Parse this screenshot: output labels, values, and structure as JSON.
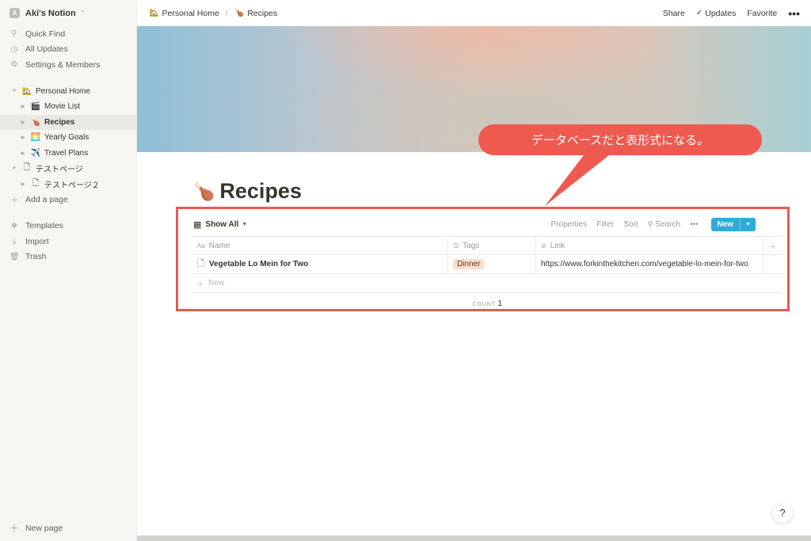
{
  "workspace": {
    "name": "Aki's Notion",
    "initial": "A"
  },
  "sidebar": {
    "top_items": [
      {
        "label": "Quick Find",
        "icon": "search-icon"
      },
      {
        "label": "All Updates",
        "icon": "clock-icon"
      },
      {
        "label": "Settings & Members",
        "icon": "gear-icon"
      }
    ],
    "tree": [
      {
        "label": "Personal Home",
        "emoji": "🏡",
        "level": 0
      },
      {
        "label": "Movie List",
        "emoji": "🎬",
        "level": 1
      },
      {
        "label": "Recipes",
        "emoji": "🍗",
        "level": 1,
        "active": true
      },
      {
        "label": "Yearly Goals",
        "emoji": "🌅",
        "level": 1
      },
      {
        "label": "Travel Plans",
        "emoji": "✈️",
        "level": 1
      },
      {
        "label": "テストページ",
        "emoji": "📄",
        "level": 0
      },
      {
        "label": "テストページ２",
        "emoji": "📄",
        "level": 1
      }
    ],
    "add_page": "Add a page",
    "bottom_items": [
      {
        "label": "Templates",
        "icon": "templates-icon"
      },
      {
        "label": "Import",
        "icon": "import-icon"
      },
      {
        "label": "Trash",
        "icon": "trash-icon"
      }
    ],
    "new_page": "New page"
  },
  "topbar": {
    "breadcrumb": [
      {
        "label": "Personal Home",
        "emoji": "🏡"
      },
      {
        "label": "Recipes",
        "emoji": "🍗"
      }
    ],
    "separator": "/",
    "share": "Share",
    "updates": "Updates",
    "favorite": "Favorite",
    "more": "•••"
  },
  "callout": {
    "text": "データベースだと表形式になる。",
    "color": "#ee5a4f"
  },
  "page": {
    "title": "Recipes",
    "emoji": "🍗"
  },
  "database": {
    "view": "Show All",
    "actions": {
      "properties": "Properties",
      "filter": "Filter",
      "sort": "Sort",
      "search": "Search",
      "more": "•••",
      "new": "New"
    },
    "columns": [
      {
        "label": "Name",
        "icon": "Aa"
      },
      {
        "label": "Tags",
        "icon": "☰"
      },
      {
        "label": "Link",
        "icon": "🔗"
      }
    ],
    "rows": [
      {
        "name": "Vegetable Lo Mein for Two",
        "tag": "Dinner",
        "link": "https://www.forkinthekitchen.com/vegetable-lo-mein-for-two"
      }
    ],
    "new_row": "New",
    "count_label": "COUNT",
    "count_value": "1"
  },
  "help": "?",
  "colors": {
    "accent": "#2eaadc",
    "highlight": "#ea5a50",
    "tag_bg": "#fadec9"
  }
}
